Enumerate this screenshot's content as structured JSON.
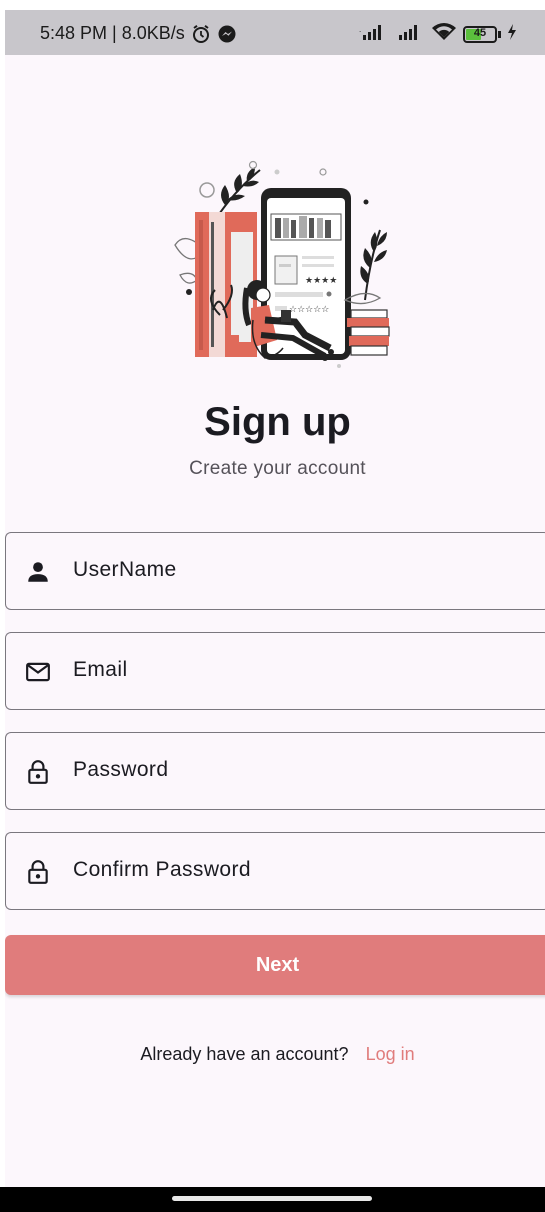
{
  "status_bar": {
    "time_speed": "5:48 PM | 8.0KB/s",
    "battery_level": "45",
    "icons": [
      "alarm-icon",
      "messenger-icon",
      "signal-icon",
      "signal-icon",
      "wifi-icon",
      "battery-icon",
      "charging-icon"
    ]
  },
  "header": {
    "title": "Sign up",
    "subtitle": "Create your account"
  },
  "form": {
    "username_placeholder": "UserName",
    "email_placeholder": "Email",
    "password_placeholder": "Password",
    "confirm_password_placeholder": "Confirm Password",
    "next_label": "Next"
  },
  "footer": {
    "prompt": "Already have an account?",
    "login_label": "Log in"
  },
  "colors": {
    "accent": "#e07c7c",
    "background": "#fcf7fc",
    "text": "#1b1b21",
    "status_bar": "#c8c6cb"
  }
}
